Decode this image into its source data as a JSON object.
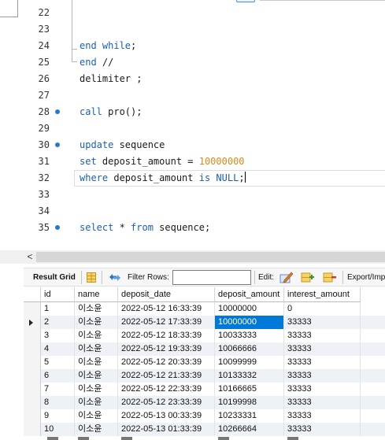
{
  "editor": {
    "lines": [
      {
        "num": "22",
        "tokens": [],
        "breakpoint": false
      },
      {
        "num": "23",
        "tokens": [],
        "breakpoint": false
      },
      {
        "num": "24",
        "tokens": [
          {
            "t": "end while",
            "c": "kw"
          },
          {
            "t": ";",
            "c": ""
          }
        ],
        "breakpoint": false
      },
      {
        "num": "25",
        "tokens": [
          {
            "t": "end",
            "c": "kw"
          },
          {
            "t": " //",
            "c": ""
          }
        ],
        "breakpoint": false
      },
      {
        "num": "26",
        "tokens": [
          {
            "t": "delimiter ;",
            "c": ""
          }
        ],
        "breakpoint": false
      },
      {
        "num": "27",
        "tokens": [],
        "breakpoint": false
      },
      {
        "num": "28",
        "tokens": [
          {
            "t": "call",
            "c": "kw"
          },
          {
            "t": " pro();",
            "c": ""
          }
        ],
        "breakpoint": true
      },
      {
        "num": "29",
        "tokens": [],
        "breakpoint": false
      },
      {
        "num": "30",
        "tokens": [
          {
            "t": "update",
            "c": "kw"
          },
          {
            "t": " sequence",
            "c": ""
          }
        ],
        "breakpoint": true
      },
      {
        "num": "31",
        "tokens": [
          {
            "t": "set",
            "c": "kw"
          },
          {
            "t": " deposit_amount = ",
            "c": ""
          },
          {
            "t": "10000000",
            "c": "num"
          }
        ],
        "breakpoint": false
      },
      {
        "num": "32",
        "tokens": [
          {
            "t": "where",
            "c": "kw"
          },
          {
            "t": " deposit_amount ",
            "c": ""
          },
          {
            "t": "is",
            "c": "kw"
          },
          {
            "t": " ",
            "c": ""
          },
          {
            "t": "NULL",
            "c": "kw"
          },
          {
            "t": ";",
            "c": ""
          }
        ],
        "breakpoint": false,
        "caret": true
      },
      {
        "num": "33",
        "tokens": [],
        "breakpoint": false
      },
      {
        "num": "34",
        "tokens": [],
        "breakpoint": false
      },
      {
        "num": "35",
        "tokens": [
          {
            "t": "select",
            "c": "kw"
          },
          {
            "t": " * ",
            "c": ""
          },
          {
            "t": "from",
            "c": "kw"
          },
          {
            "t": " sequence;",
            "c": ""
          }
        ],
        "breakpoint": true
      }
    ]
  },
  "scrollbar": {
    "left_arrow": "<"
  },
  "toolbar": {
    "result_grid_label": "Result Grid",
    "filter_label": "Filter Rows:",
    "filter_value": "",
    "edit_label": "Edit:",
    "export_label": "Export/Imp",
    "icons": [
      "grid-icon",
      "filter-icon",
      "edit-icon",
      "add-row-icon",
      "delete-row-icon"
    ]
  },
  "grid": {
    "columns": [
      "id",
      "name",
      "deposit_date",
      "deposit_amount",
      "interest_amount"
    ],
    "rows": [
      [
        "1",
        "이소윤",
        "2022-05-12 16:33:39",
        "10000000",
        "0"
      ],
      [
        "2",
        "이소윤",
        "2022-05-12 17:33:39",
        "10000000",
        "33333"
      ],
      [
        "3",
        "이소윤",
        "2022-05-12 18:33:39",
        "10033333",
        "33333"
      ],
      [
        "4",
        "이소윤",
        "2022-05-12 19:33:39",
        "10066666",
        "33333"
      ],
      [
        "5",
        "이소윤",
        "2022-05-12 20:33:39",
        "10099999",
        "33333"
      ],
      [
        "6",
        "이소윤",
        "2022-05-12 21:33:39",
        "10133332",
        "33333"
      ],
      [
        "7",
        "이소윤",
        "2022-05-12 22:33:39",
        "10166665",
        "33333"
      ],
      [
        "8",
        "이소윤",
        "2022-05-12 23:33:39",
        "10199998",
        "33333"
      ],
      [
        "9",
        "이소윤",
        "2022-05-13 00:33:39",
        "10233331",
        "33333"
      ],
      [
        "10",
        "이소윤",
        "2022-05-13 01:33:39",
        "10266664",
        "33333"
      ]
    ],
    "current_row": 1,
    "selected_column": 3
  },
  "colors": {
    "keyword": "#1b5fb3",
    "number": "#d88a1c",
    "breakpoint": "#2a78c8",
    "selection": "#0078d7",
    "alt_row": "#eef1f5"
  }
}
